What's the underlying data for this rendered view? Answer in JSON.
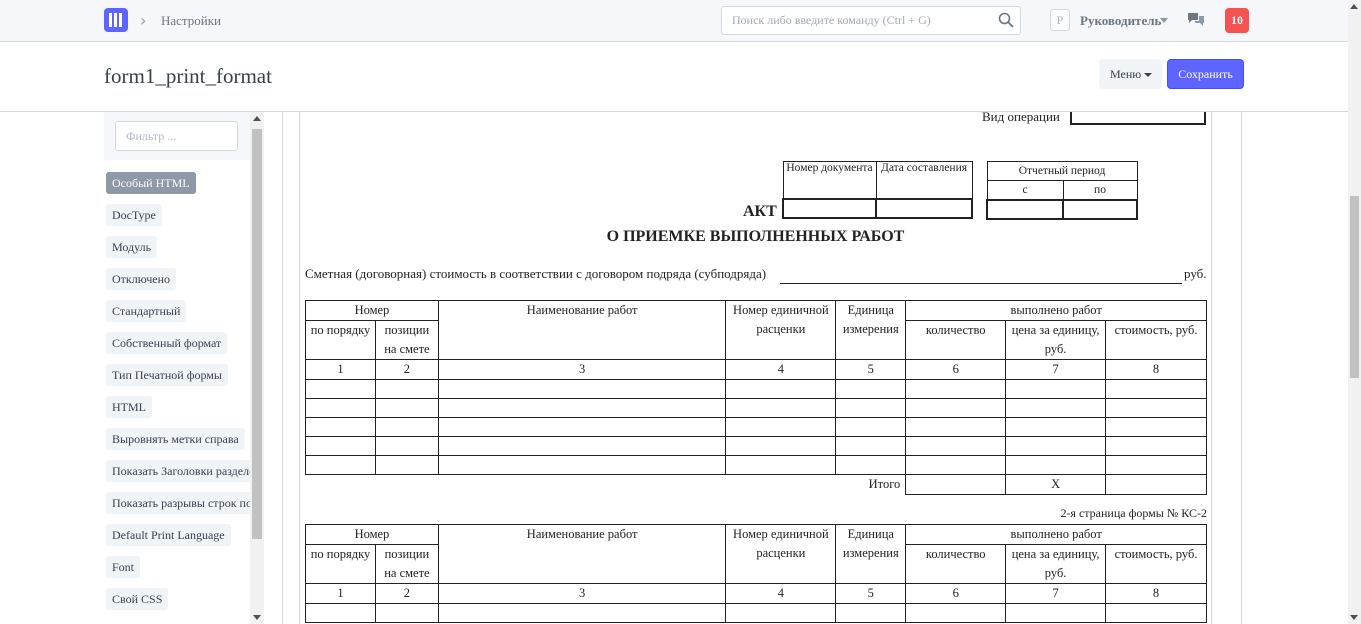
{
  "navbar": {
    "breadcrumb": "Настройки",
    "search_placeholder": "Поиск либо введите команду (Ctrl + G)",
    "avatar_letter": "Р",
    "user_name": "Руководитель",
    "notifications": "10"
  },
  "page": {
    "title": "form1_print_format",
    "menu_label": "Меню",
    "save_label": "Сохранить"
  },
  "sidebar": {
    "filter_placeholder": "Фильтр ...",
    "items": [
      "Особый HTML",
      "DocType",
      "Модуль",
      "Отключено",
      "Стандартный",
      "Собственный формат",
      "Тип Печатной формы",
      "HTML",
      "Выровнять метки справа",
      "Показать Заголовки разделов",
      "Показать разрывы строк после разделов",
      "Default Print Language",
      "Font",
      "Свой CSS"
    ]
  },
  "document": {
    "operation_label": "Вид операции",
    "doc_number_header": "Номер документа",
    "doc_date_header": "Дата составления",
    "period_header": "Отчетный период",
    "period_from": "с",
    "period_to": "по",
    "title_line1": "АКТ",
    "title_line2": "О ПРИЕМКЕ ВЫПОЛНЕННЫХ РАБОТ",
    "estimate_text": "Сметная (договорная) стоимость в соответствии с договором подряда (субподряда)",
    "currency": "руб.",
    "table": {
      "number_header": "Номер",
      "by_order": "по порядку",
      "estimate_pos_line1": "позиции",
      "estimate_pos_line2": "на смете",
      "work_name": "Наименование работ",
      "unit_price_no_line1": "Номер единичной",
      "unit_price_no_line2": "расценки",
      "unit_line1": "Единица",
      "unit_line2": "измерения",
      "done_header": "выполнено работ",
      "quantity": "количество",
      "price_line1": "цена за единицу,",
      "price_line2": "руб.",
      "cost": "стоимость, руб.",
      "col_numbers": [
        "1",
        "2",
        "3",
        "4",
        "5",
        "6",
        "7",
        "8"
      ],
      "total_label": "Итого",
      "total_x": "Х"
    },
    "page2_note": "2-я страница формы № КС-2"
  }
}
